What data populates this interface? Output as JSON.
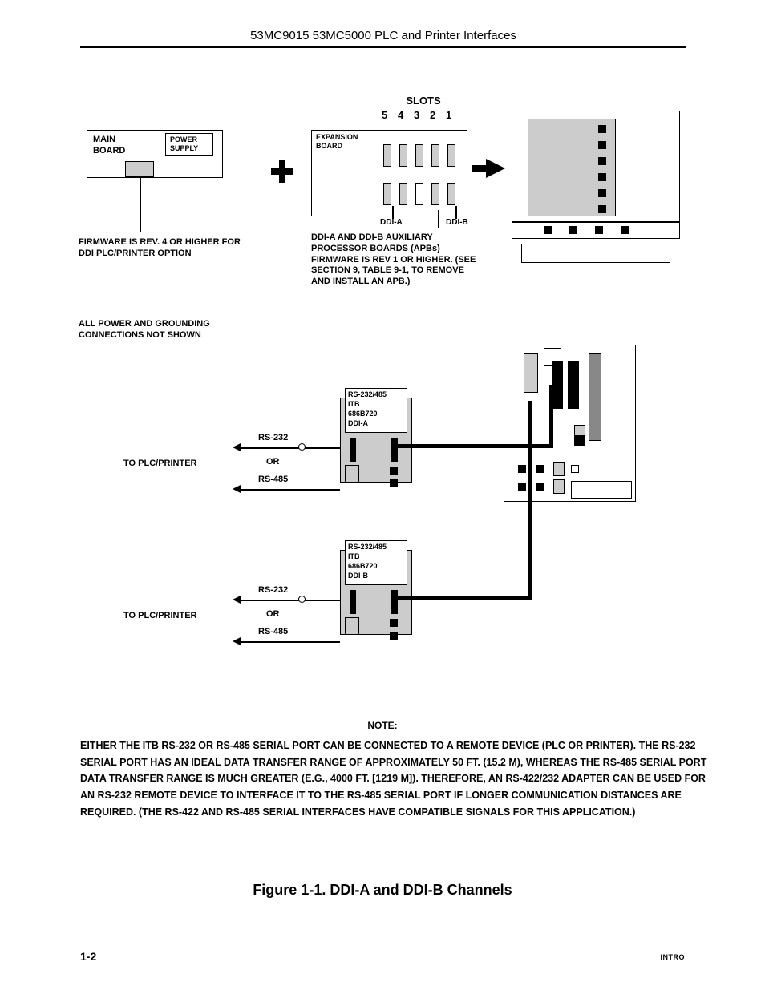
{
  "header": {
    "title": "53MC9015  53MC5000 PLC and Printer Interfaces"
  },
  "top": {
    "main_board": "MAIN BOARD",
    "power_supply": "POWER SUPPLY",
    "firmware_note": "FIRMWARE IS REV. 4 OR HIGHER FOR DDI PLC/PRINTER OPTION",
    "slots_title": "SLOTS",
    "slot5": "5",
    "slot4": "4",
    "slot3": "3",
    "slot2": "2",
    "slot1": "1",
    "expansion": "EXPANSION BOARD",
    "ddi_a": "DDI-A",
    "ddi_b": "DDI-B",
    "apb_note": "DDI-A AND DDI-B AUXILIARY PROCESSOR BOARDS (APBs) FIRMWARE IS REV 1 OR HIGHER.  (SEE SECTION 9, TABLE 9-1, TO REMOVE AND INSTALL AN APB.)"
  },
  "mid": {
    "grounding": "ALL POWER AND GROUNDING CONNECTIONS NOT SHOWN",
    "itb_a_l1": "RS-232/485",
    "itb_a_l2": "ITB",
    "itb_a_l3": "686B720",
    "itb_a_l4": "DDI-A",
    "itb_b_l1": "RS-232/485",
    "itb_b_l2": "ITB",
    "itb_b_l3": "686B720",
    "itb_b_l4": "DDI-B",
    "rs232": "RS-232",
    "or": "OR",
    "rs485": "RS-485",
    "to_plc": "TO PLC/PRINTER"
  },
  "note": {
    "title": "NOTE:",
    "body": "EITHER THE ITB RS-232 OR RS-485 SERIAL PORT CAN BE CONNECTED TO A REMOTE DEVICE (PLC OR PRINTER). THE RS-232 SERIAL PORT HAS AN IDEAL DATA TRANSFER RANGE OF APPROXIMATELY 50 FT. (15.2 M), WHEREAS THE RS-485 SERIAL PORT DATA TRANSFER RANGE IS MUCH GREATER (E.G., 4000 FT. [1219 M]). THEREFORE, AN RS-422/232 ADAPTER CAN BE USED FOR AN RS-232 REMOTE DEVICE TO INTERFACE IT TO THE RS-485 SERIAL PORT IF LONGER COMMUNICATION DISTANCES ARE REQUIRED.  (THE RS-422 AND RS-485 SERIAL INTERFACES HAVE COMPATIBLE SIGNALS FOR THIS APPLICATION.)"
  },
  "caption": "Figure 1-1.  DDI-A and DDI-B Channels",
  "footer": {
    "page": "1-2",
    "section": "INTRO"
  }
}
